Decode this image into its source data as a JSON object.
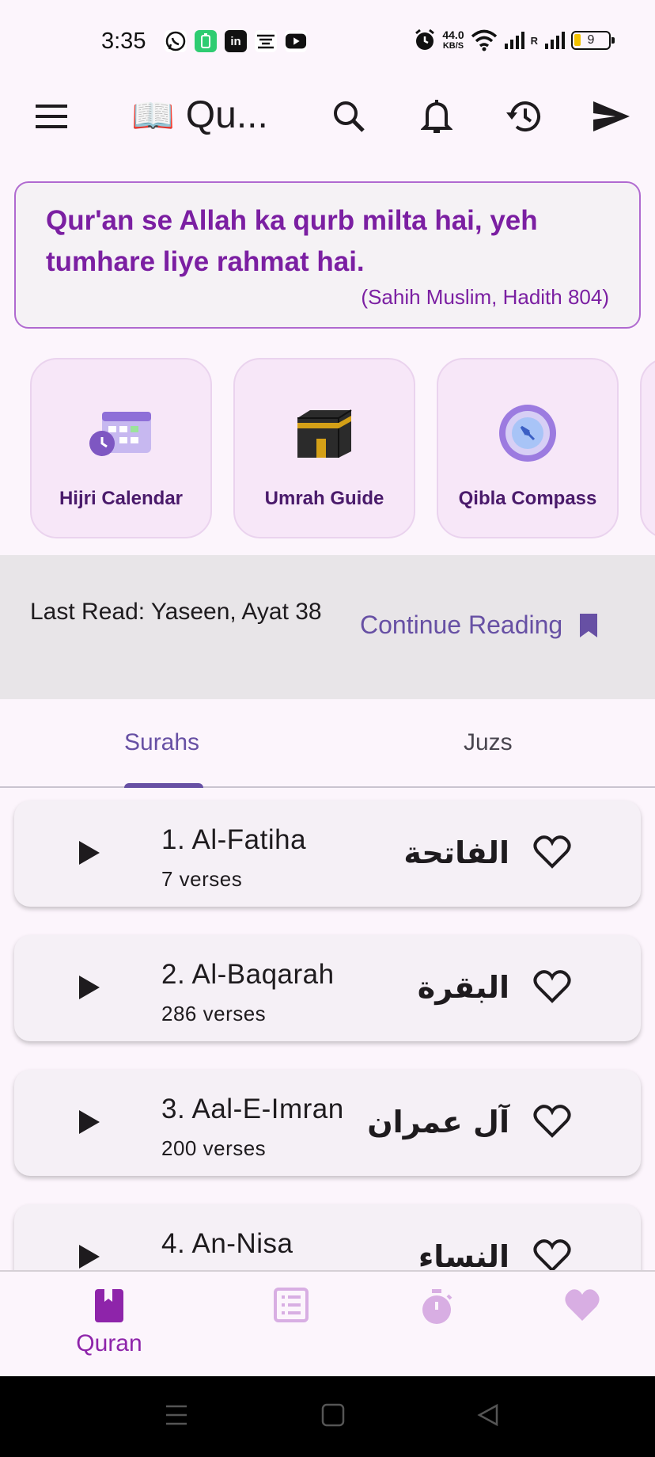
{
  "status_bar": {
    "time": "3:35",
    "apps": [
      "whatsapp-icon",
      "battery-saver-icon",
      "linkedin-icon",
      "app-icon",
      "youtube-icon"
    ],
    "net_speed_value": "44.0",
    "net_speed_unit": "KB/S",
    "battery": "9",
    "sim_label": "R"
  },
  "app_bar": {
    "title": "Qu...",
    "title_emoji": "📖",
    "icons": [
      "menu-icon",
      "search-icon",
      "bell-icon",
      "history-icon",
      "send-icon"
    ]
  },
  "quote": {
    "text": "Qur'an se Allah ka qurb milta hai, yeh tumhare liye rahmat hai.",
    "reference": "(Sahih Muslim, Hadith 804)"
  },
  "features": [
    {
      "label": "Hijri Calendar",
      "icon": "calendar-icon"
    },
    {
      "label": "Umrah Guide",
      "icon": "kaaba-icon"
    },
    {
      "label": "Qibla Compass",
      "icon": "compass-icon"
    }
  ],
  "last_read": {
    "text": "Last Read: Yaseen, Ayat 38",
    "button": "Continue Reading"
  },
  "tabs": [
    {
      "label": "Surahs",
      "active": true
    },
    {
      "label": "Juzs",
      "active": false
    }
  ],
  "surahs": [
    {
      "name": "1. Al-Fatiha",
      "verses": "7 verses",
      "arabic": "الفاتحة"
    },
    {
      "name": "2. Al-Baqarah",
      "verses": "286 verses",
      "arabic": "البقرة"
    },
    {
      "name": "3. Aal-E-Imran",
      "verses": "200 verses",
      "arabic": "آل عمران"
    },
    {
      "name": "4. An-Nisa",
      "verses": "",
      "arabic": "النساء"
    }
  ],
  "bottom_nav": [
    {
      "label": "Quran",
      "icon": "book-icon",
      "active": true
    },
    {
      "label": "",
      "icon": "list-icon",
      "active": false
    },
    {
      "label": "",
      "icon": "stopwatch-icon",
      "active": false
    },
    {
      "label": "",
      "icon": "heart-icon",
      "active": false
    }
  ],
  "colors": {
    "accent": "#6750a4",
    "brand_purple": "#7b1fa2",
    "background": "#fcf5fc"
  }
}
